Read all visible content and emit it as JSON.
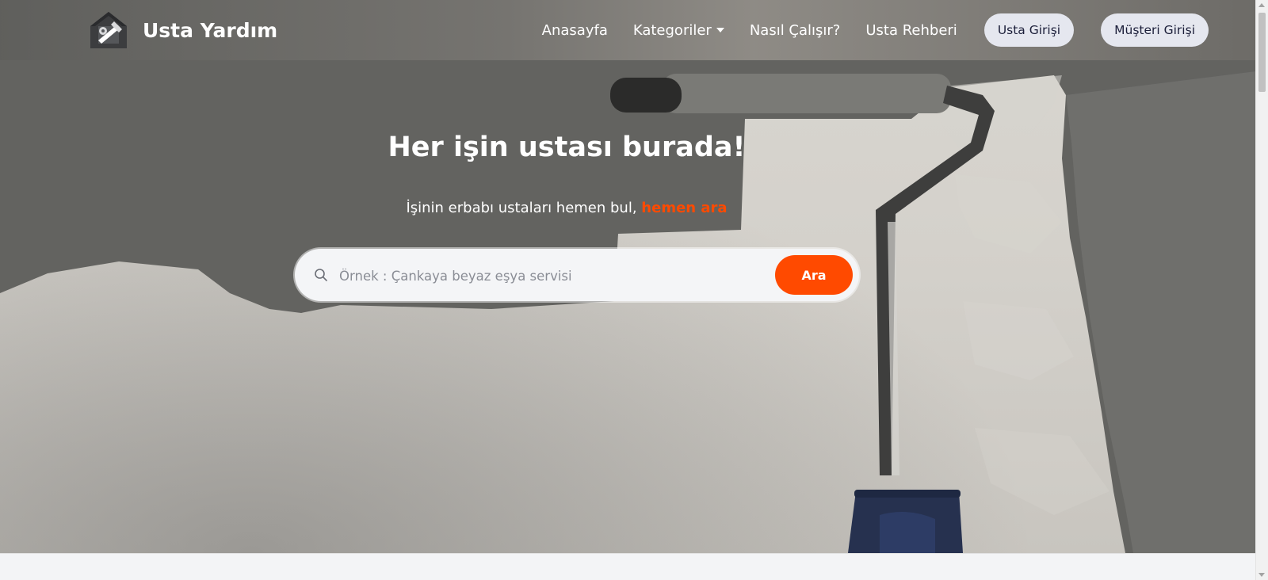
{
  "brand": {
    "name": "Usta Yardım",
    "logo_icon": "house-tools-logo-icon"
  },
  "nav": {
    "links": [
      {
        "label": "Anasayfa"
      },
      {
        "label": "Kategoriler",
        "has_dropdown": true
      },
      {
        "label": "Nasıl Çalışır?"
      },
      {
        "label": "Usta Rehberi"
      }
    ],
    "usta_login": "Usta Girişi",
    "customer_login": "Müşteri Girişi"
  },
  "hero": {
    "title": "Her işin ustası burada!",
    "subtitle_prefix": "İşinin erbabı ustaları hemen bul, ",
    "subtitle_accent": "hemen ara",
    "background_icon": "paint-roller-wall-image"
  },
  "search": {
    "placeholder": "Örnek : Çankaya beyaz eşya servisi",
    "value": "",
    "button_label": "Ara",
    "icon": "search-icon"
  },
  "colors": {
    "accent": "#ff4a00",
    "pill_bg": "#e5e7ef",
    "pill_text": "#1c1f3a"
  }
}
